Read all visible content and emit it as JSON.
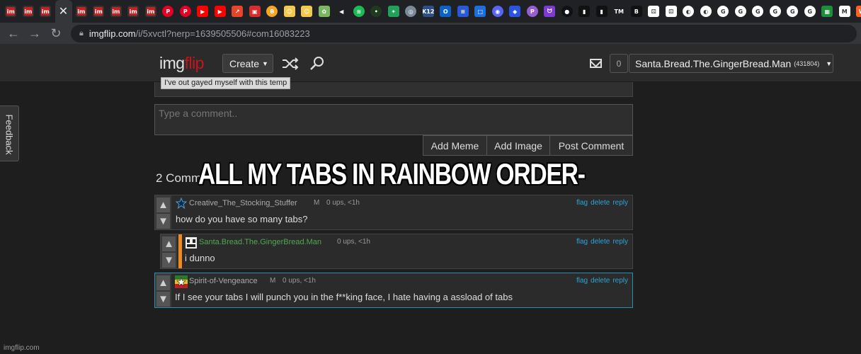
{
  "browser": {
    "url_host": "imgflip.com",
    "url_path": "/i/5xvctl?nerp=1639505506#com16083223",
    "tabs": [
      {
        "icon": "imgflip-favicon",
        "label": "im",
        "color": "#c22222"
      },
      {
        "icon": "imgflip-favicon",
        "label": "im",
        "color": "#c22222"
      },
      {
        "icon": "imgflip-favicon",
        "label": "im",
        "color": "#c22222"
      },
      {
        "icon": "close-tab-icon",
        "label": "✕",
        "color": "#35363a",
        "active": true
      },
      {
        "icon": "imgflip-favicon",
        "label": "im",
        "color": "#c22222"
      },
      {
        "icon": "imgflip-favicon",
        "label": "im",
        "color": "#c22222"
      },
      {
        "icon": "imgflip-favicon",
        "label": "im",
        "color": "#c22222"
      },
      {
        "icon": "imgflip-favicon",
        "label": "im",
        "color": "#c22222"
      },
      {
        "icon": "imgflip-favicon",
        "label": "im",
        "color": "#c22222"
      },
      {
        "icon": "pinterest-favicon",
        "label": "P",
        "color": "#e60023",
        "round": true
      },
      {
        "icon": "pinterest-favicon",
        "label": "P",
        "color": "#e60023",
        "round": true
      },
      {
        "icon": "youtube-favicon",
        "label": "▶",
        "color": "#ff0000"
      },
      {
        "icon": "youtube-favicon",
        "label": "▶",
        "color": "#ff0000"
      },
      {
        "icon": "red-app-favicon",
        "label": "↗",
        "color": "#e8432b"
      },
      {
        "icon": "red-app-favicon",
        "label": "▣",
        "color": "#d62d2d"
      },
      {
        "icon": "orange-circle-favicon",
        "label": "B",
        "color": "#f5a623",
        "round": true
      },
      {
        "icon": "yellow-face-favicon",
        "label": "☺",
        "color": "#f2c94c"
      },
      {
        "icon": "yellow-face-favicon",
        "label": "☺",
        "color": "#f2c94c"
      },
      {
        "icon": "cartoon-favicon",
        "label": "✿",
        "color": "#7bb661"
      },
      {
        "icon": "speaker-icon",
        "label": "◀",
        "color": "#202124"
      },
      {
        "icon": "spotify-favicon",
        "label": "≋",
        "color": "#1db954",
        "round": true
      },
      {
        "icon": "dark-circle-favicon",
        "label": "•",
        "color": "#1e3b1e",
        "round": true
      },
      {
        "icon": "green-leaf-favicon",
        "label": "✦",
        "color": "#22a05a"
      },
      {
        "icon": "globe-favicon",
        "label": "◎",
        "color": "#7a8a99",
        "round": true
      },
      {
        "icon": "k12-favicon",
        "label": "K12",
        "color": "#2d4f8a"
      },
      {
        "icon": "outlook-favicon",
        "label": "O",
        "color": "#0a64c8"
      },
      {
        "icon": "blue-bars-favicon",
        "label": "≡",
        "color": "#2b58d8"
      },
      {
        "icon": "blue-square-favicon",
        "label": "□",
        "color": "#1e6fd9"
      },
      {
        "icon": "discord-favicon",
        "label": "◉",
        "color": "#5865f2",
        "round": true
      },
      {
        "icon": "blue-diamond-favicon",
        "label": "◆",
        "color": "#2a55e0"
      },
      {
        "icon": "purple-p-favicon",
        "label": "P",
        "color": "#9a5cd0",
        "round": true
      },
      {
        "icon": "purple-cat-favicon",
        "label": "ᗢ",
        "color": "#7d3bd4"
      },
      {
        "icon": "black-circle-favicon",
        "label": "●",
        "color": "#111111",
        "round": true
      },
      {
        "icon": "black-favicon",
        "label": "▮",
        "color": "#111111"
      },
      {
        "icon": "black-favicon",
        "label": "▮",
        "color": "#111111"
      },
      {
        "icon": "tm-favicon",
        "label": "TM",
        "color": "#202124"
      },
      {
        "icon": "black-b-favicon",
        "label": "B",
        "color": "#111111"
      },
      {
        "icon": "dice-favicon",
        "label": "⚄",
        "color": "#ffffff"
      },
      {
        "icon": "dice-favicon",
        "label": "⚄",
        "color": "#ffffff"
      },
      {
        "icon": "white-globe-favicon",
        "label": "◐",
        "color": "#ffffff",
        "round": true
      },
      {
        "icon": "white-globe-favicon",
        "label": "◐",
        "color": "#ffffff",
        "round": true
      },
      {
        "icon": "google-favicon",
        "label": "G",
        "color": "#ffffff",
        "round": true
      },
      {
        "icon": "google-favicon",
        "label": "G",
        "color": "#ffffff",
        "round": true
      },
      {
        "icon": "google-favicon",
        "label": "G",
        "color": "#ffffff",
        "round": true
      },
      {
        "icon": "google-favicon",
        "label": "G",
        "color": "#ffffff",
        "round": true
      },
      {
        "icon": "google-favicon",
        "label": "G",
        "color": "#ffffff",
        "round": true
      },
      {
        "icon": "google-favicon",
        "label": "G",
        "color": "#ffffff",
        "round": true
      },
      {
        "icon": "classroom-favicon",
        "label": "▦",
        "color": "#1e8e3e"
      },
      {
        "icon": "gmail-favicon",
        "label": "M",
        "color": "#ffffff"
      },
      {
        "icon": "wattpad-favicon",
        "label": "W",
        "color": "#ff6122"
      }
    ]
  },
  "header": {
    "logo_white": "img",
    "logo_red": "flip",
    "create_label": "Create",
    "notif_count": "0",
    "username": "Santa.Bread.The.GingerBread.Man",
    "points": "(431804)"
  },
  "page": {
    "tag_text": "I've out gayed myself with this temp",
    "comment_placeholder": "Type a comment..",
    "add_meme": "Add Meme",
    "add_image": "Add Image",
    "post_comment": "Post Comment",
    "feedback": "Feedback",
    "comments_count": "2 Comm",
    "overlay_caption": "ALL MY TABS IN RAINBOW ORDER-"
  },
  "comments": [
    {
      "user": "Creative_The_Stocking_Stuffer",
      "gender": "M",
      "meta": "0 ups, <1h",
      "text": "how do you have so many tabs?",
      "actions": [
        "flag",
        "delete",
        "reply"
      ]
    },
    {
      "user": "Santa.Bread.The.GingerBread.Man",
      "meta": "0 ups, <1h",
      "text": "i dunno",
      "actions": [
        "flag",
        "delete",
        "reply"
      ]
    },
    {
      "user": "Spirit-of-Vengeance",
      "gender": "M",
      "meta": "0 ups, <1h",
      "text": "If I see your tabs I will punch you in the f**king face, I hate having a assload of tabs",
      "actions": [
        "flag",
        "delete",
        "reply"
      ]
    }
  ],
  "watermark": "imgflip.com"
}
